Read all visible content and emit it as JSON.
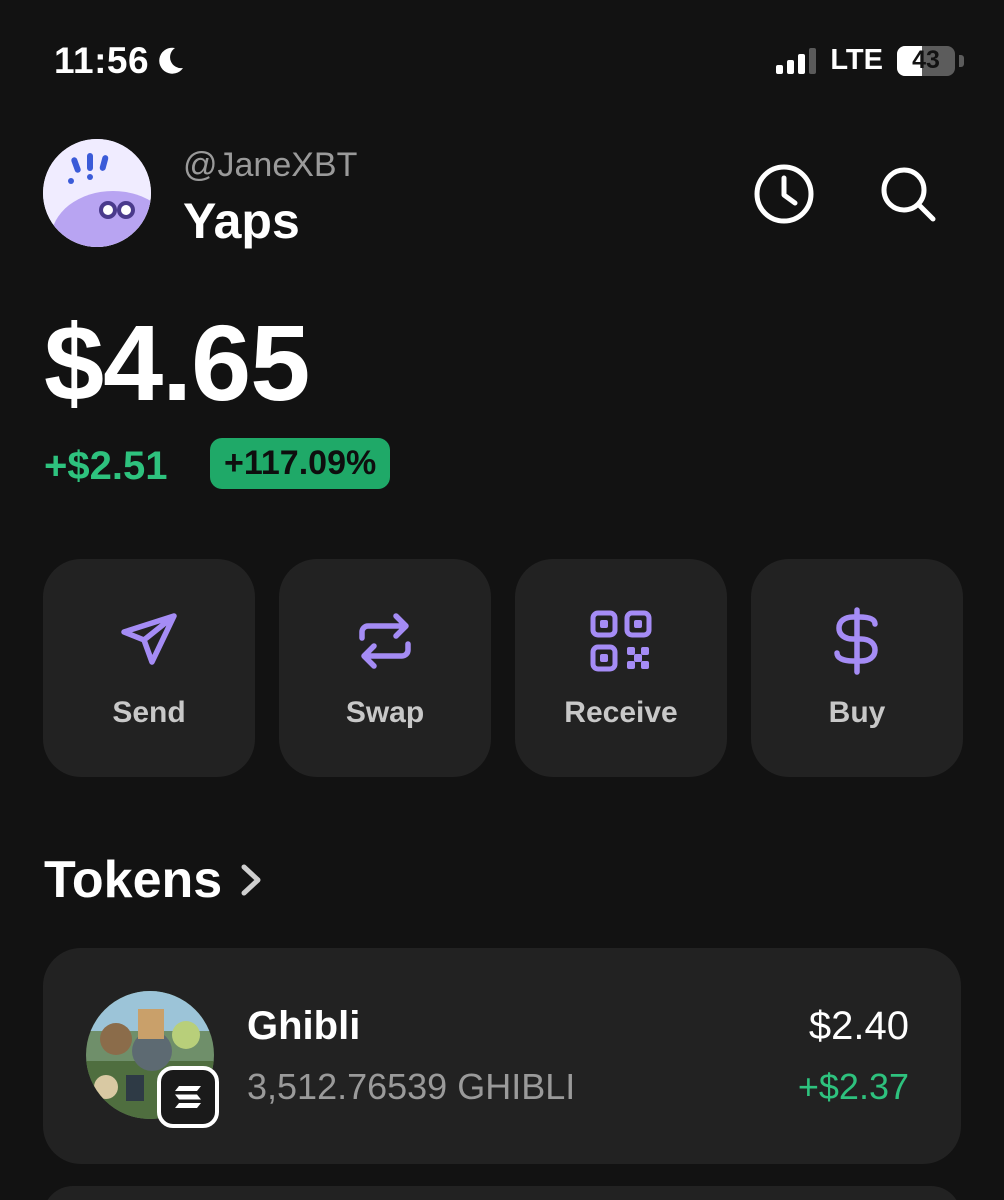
{
  "status_bar": {
    "time": "11:56",
    "network": "LTE",
    "battery": "43",
    "battery_level": 0.43
  },
  "header": {
    "handle": "@JaneXBT",
    "wallet_name": "Yaps"
  },
  "balance": {
    "total": "$4.65",
    "change": "+$2.51",
    "change_percent": "+117.09%"
  },
  "actions": [
    {
      "label": "Send",
      "icon": "send-icon"
    },
    {
      "label": "Swap",
      "icon": "swap-icon"
    },
    {
      "label": "Receive",
      "icon": "qr-code-icon"
    },
    {
      "label": "Buy",
      "icon": "dollar-icon"
    }
  ],
  "tokens": {
    "title": "Tokens",
    "items": [
      {
        "name": "Ghibli",
        "amount": "3,512.76539 GHIBLI",
        "value": "$2.40",
        "change": "+$2.37"
      }
    ]
  },
  "colors": {
    "background": "#121212",
    "card": "#222222",
    "accent": "#a58cf5",
    "positive": "#2ec27e",
    "badge": "#1fa968"
  }
}
